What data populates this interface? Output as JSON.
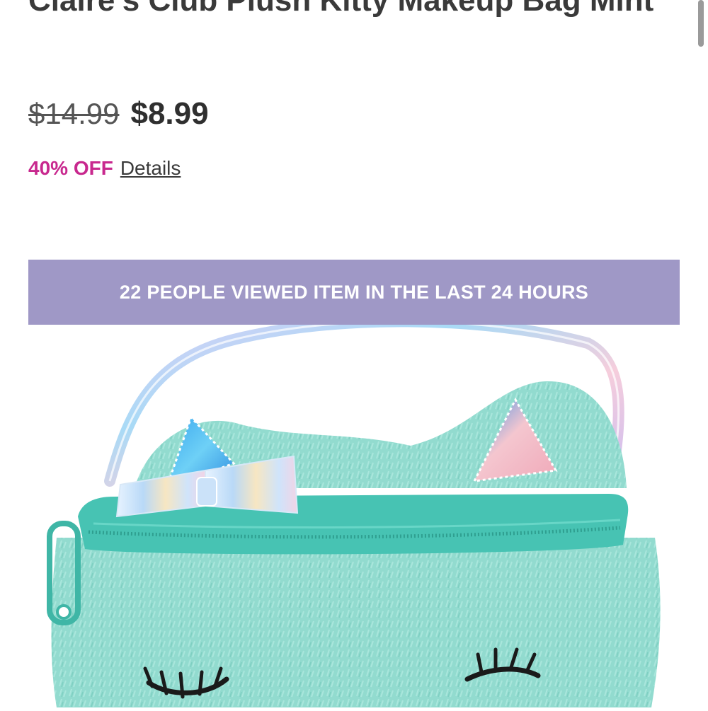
{
  "product": {
    "title": "Claire's Club Plush Kitty Makeup Bag Mint",
    "original_price": "$14.99",
    "sale_price": "$8.99",
    "discount_label": "40% OFF",
    "details_link": "Details"
  },
  "banner": {
    "text": "22 PEOPLE VIEWED ITEM IN THE LAST 24 HOURS"
  },
  "colors": {
    "banner_bg": "#9f98c6",
    "discount": "#c8288e",
    "bag_mint": "#8ed9cd",
    "zipper": "#45c2b1"
  },
  "icons": {
    "scrollbar": "scrollbar-thumb"
  }
}
